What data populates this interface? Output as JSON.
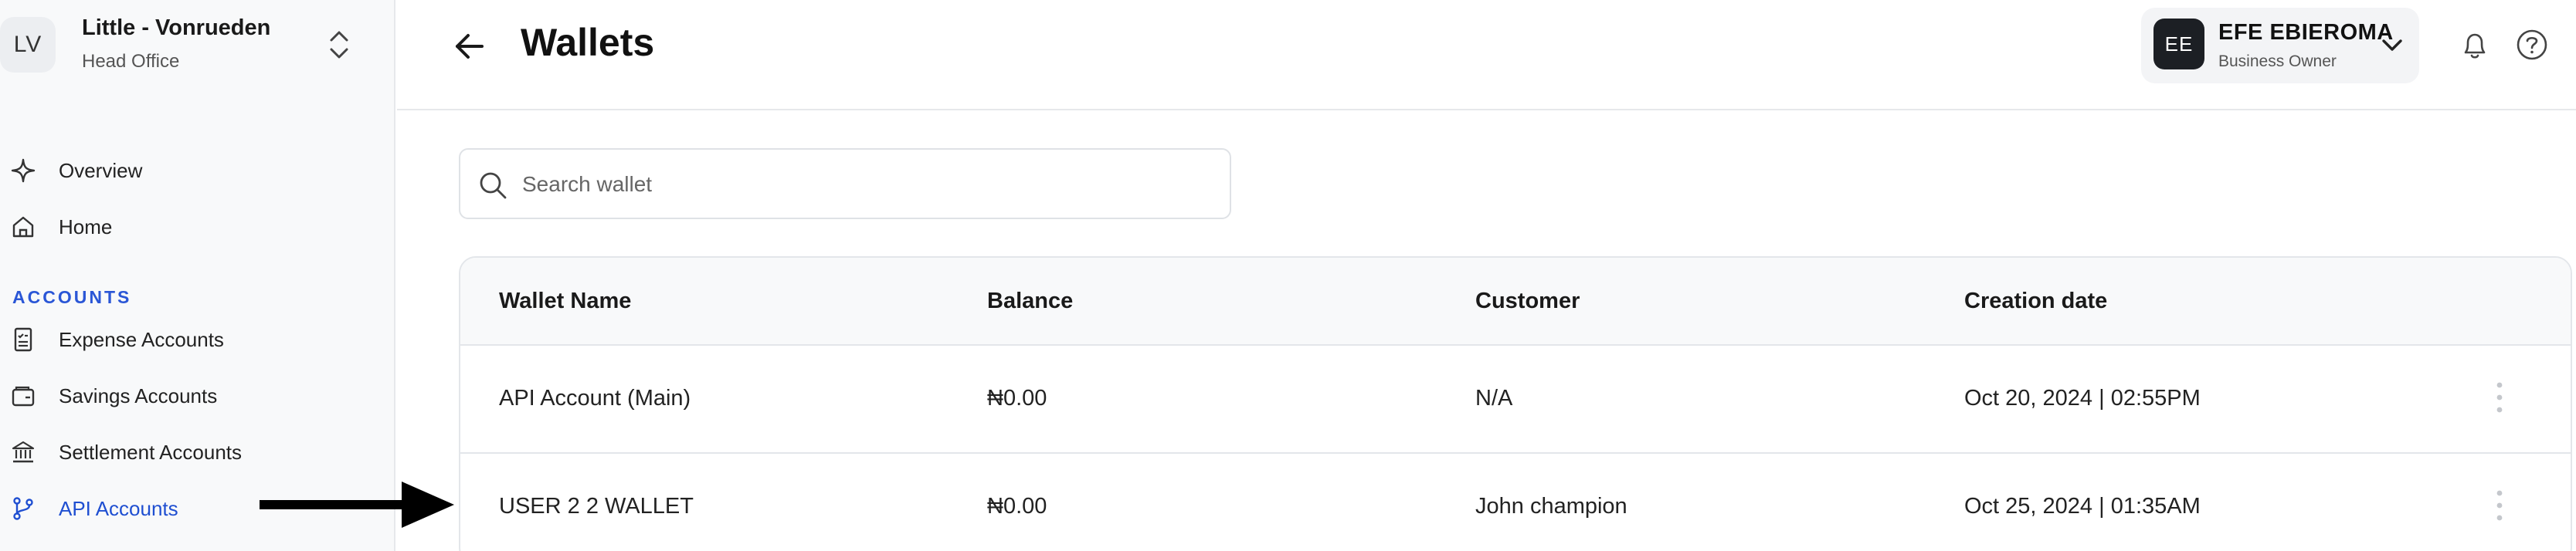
{
  "org": {
    "initials": "LV",
    "name": "Little - Vonrueden",
    "branch": "Head Office"
  },
  "nav": {
    "overview": "Overview",
    "home": "Home",
    "accounts_section": "ACCOUNTS",
    "expense": "Expense Accounts",
    "savings": "Savings Accounts",
    "settlement": "Settlement Accounts",
    "api": "API Accounts"
  },
  "header": {
    "title": "Wallets"
  },
  "user": {
    "initials": "EE",
    "name": "EFE EBIEROMA",
    "role": "Business Owner"
  },
  "search": {
    "placeholder": "Search wallet",
    "value": ""
  },
  "table": {
    "columns": [
      "Wallet Name",
      "Balance",
      "Customer",
      "Creation date"
    ],
    "rows": [
      [
        "API Account (Main)",
        "₦0.00",
        "N/A",
        "Oct 20, 2024 | 02:55PM"
      ],
      [
        "USER 2 2 WALLET",
        "₦0.00",
        "John champion",
        "Oct 25, 2024 | 01:35AM"
      ]
    ]
  },
  "colors": {
    "accent": "#1f4fd1",
    "section": "#2a56d6",
    "avatar_dark": "#1c1f24"
  },
  "icons": {
    "overview": "sparkle-icon",
    "home": "home-icon",
    "expense": "receipt-icon",
    "savings": "wallet-icon",
    "settlement": "bank-icon",
    "api": "git-branch-icon"
  }
}
